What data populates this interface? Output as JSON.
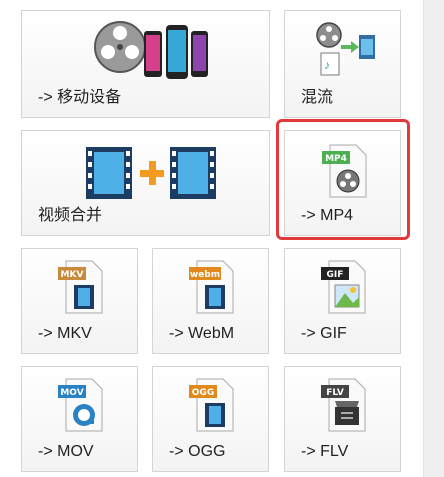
{
  "tiles": {
    "mobile": {
      "label": "-> 移动设备"
    },
    "remux": {
      "label": "混流"
    },
    "merge": {
      "label": "视频合并"
    },
    "mp4": {
      "label": "-> MP4",
      "badge": "MP4"
    },
    "mkv": {
      "label": "-> MKV",
      "badge": "MKV"
    },
    "webm": {
      "label": "-> WebM",
      "badge": "webm"
    },
    "gif": {
      "label": "-> GIF",
      "badge": "GIF"
    },
    "mov": {
      "label": "-> MOV",
      "badge": "MOV"
    },
    "ogg": {
      "label": "-> OGG",
      "badge": "OGG"
    },
    "flv": {
      "label": "-> FLV",
      "badge": "FLV"
    }
  },
  "colors": {
    "selection": "#e23a3a",
    "mp4_badge": "#4caf50",
    "mkv_badge": "#c98b3b",
    "webm_badge": "#e08a1e",
    "gif_badge": "#222222",
    "mov_badge": "#2a82c4",
    "ogg_badge": "#e08a1e",
    "flv_badge": "#444444"
  },
  "icons": [
    "film-reel-icon",
    "phone-icon",
    "remux-icon",
    "film-strip-icon",
    "plus-icon",
    "document-icon"
  ]
}
